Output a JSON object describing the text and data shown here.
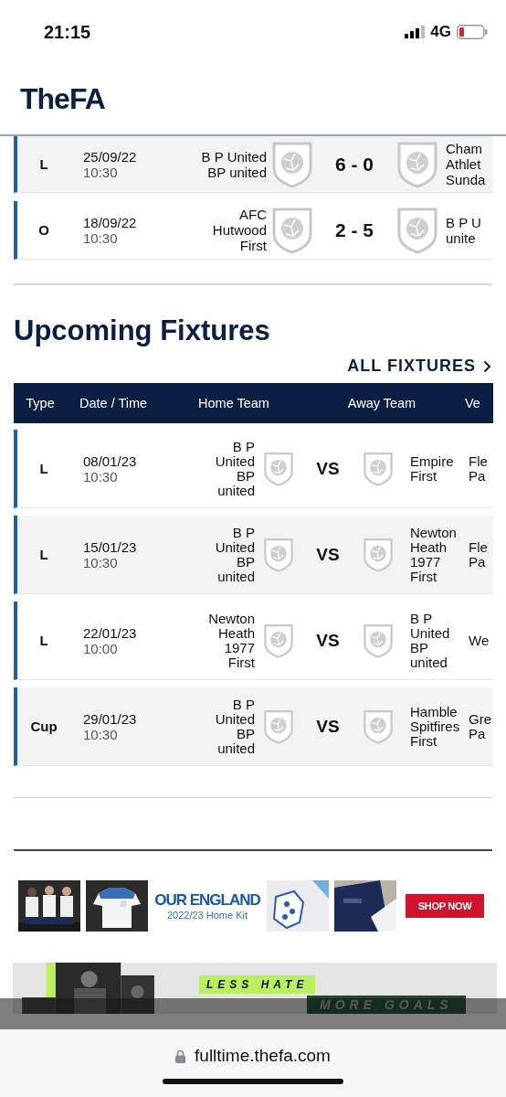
{
  "status_bar": {
    "time": "21:15",
    "network": "4G"
  },
  "header": {
    "logo": "TheFA"
  },
  "results": [
    {
      "type": "L",
      "date": "25/09/22",
      "time": "10:30",
      "home": [
        "B P United",
        "BP united"
      ],
      "score": "6 - 0",
      "away": [
        "Cham",
        "Athlet",
        "Sunda"
      ]
    },
    {
      "type": "O",
      "date": "18/09/22",
      "time": "10:30",
      "home": [
        "AFC",
        "Hutwood",
        "First"
      ],
      "score": "2 - 5",
      "away": [
        "B P U",
        "unite"
      ]
    }
  ],
  "fixtures": {
    "title": "Upcoming Fixtures",
    "all_link": "ALL FIXTURES",
    "columns": [
      "Type",
      "Date / Time",
      "Home Team",
      "Away Team",
      "Ve"
    ],
    "rows": [
      {
        "type": "L",
        "date": "08/01/23",
        "time": "10:30",
        "home": [
          "B P",
          "United",
          "BP",
          "united"
        ],
        "vs": "VS",
        "away": [
          "Empire",
          "First"
        ],
        "venue": [
          "Fle",
          "Pa"
        ]
      },
      {
        "type": "L",
        "date": "15/01/23",
        "time": "10:30",
        "home": [
          "B P",
          "United",
          "BP",
          "united"
        ],
        "vs": "VS",
        "away": [
          "Newton",
          "Heath",
          "1977",
          "First"
        ],
        "venue": [
          "Fle",
          "Pa"
        ]
      },
      {
        "type": "L",
        "date": "22/01/23",
        "time": "10:00",
        "home": [
          "Newton",
          "Heath",
          "1977",
          "First"
        ],
        "vs": "VS",
        "away": [
          "B P",
          "United",
          "BP",
          "united"
        ],
        "venue": [
          "We"
        ]
      },
      {
        "type": "Cup",
        "date": "29/01/23",
        "time": "10:30",
        "home": [
          "B P",
          "United",
          "BP",
          "united"
        ],
        "vs": "VS",
        "away": [
          "Hamble",
          "Spitfires",
          "First"
        ],
        "venue": [
          "Gre",
          "Pa"
        ]
      }
    ]
  },
  "ad": {
    "title": "OUR ENGLAND",
    "subtitle": "2022/23 Home Kit",
    "button": "SHOP NOW"
  },
  "ad2": {
    "text_1": "LESS HATE",
    "text_2": "MORE GOALS"
  },
  "browser": {
    "url": "fulltime.thefa.com"
  }
}
